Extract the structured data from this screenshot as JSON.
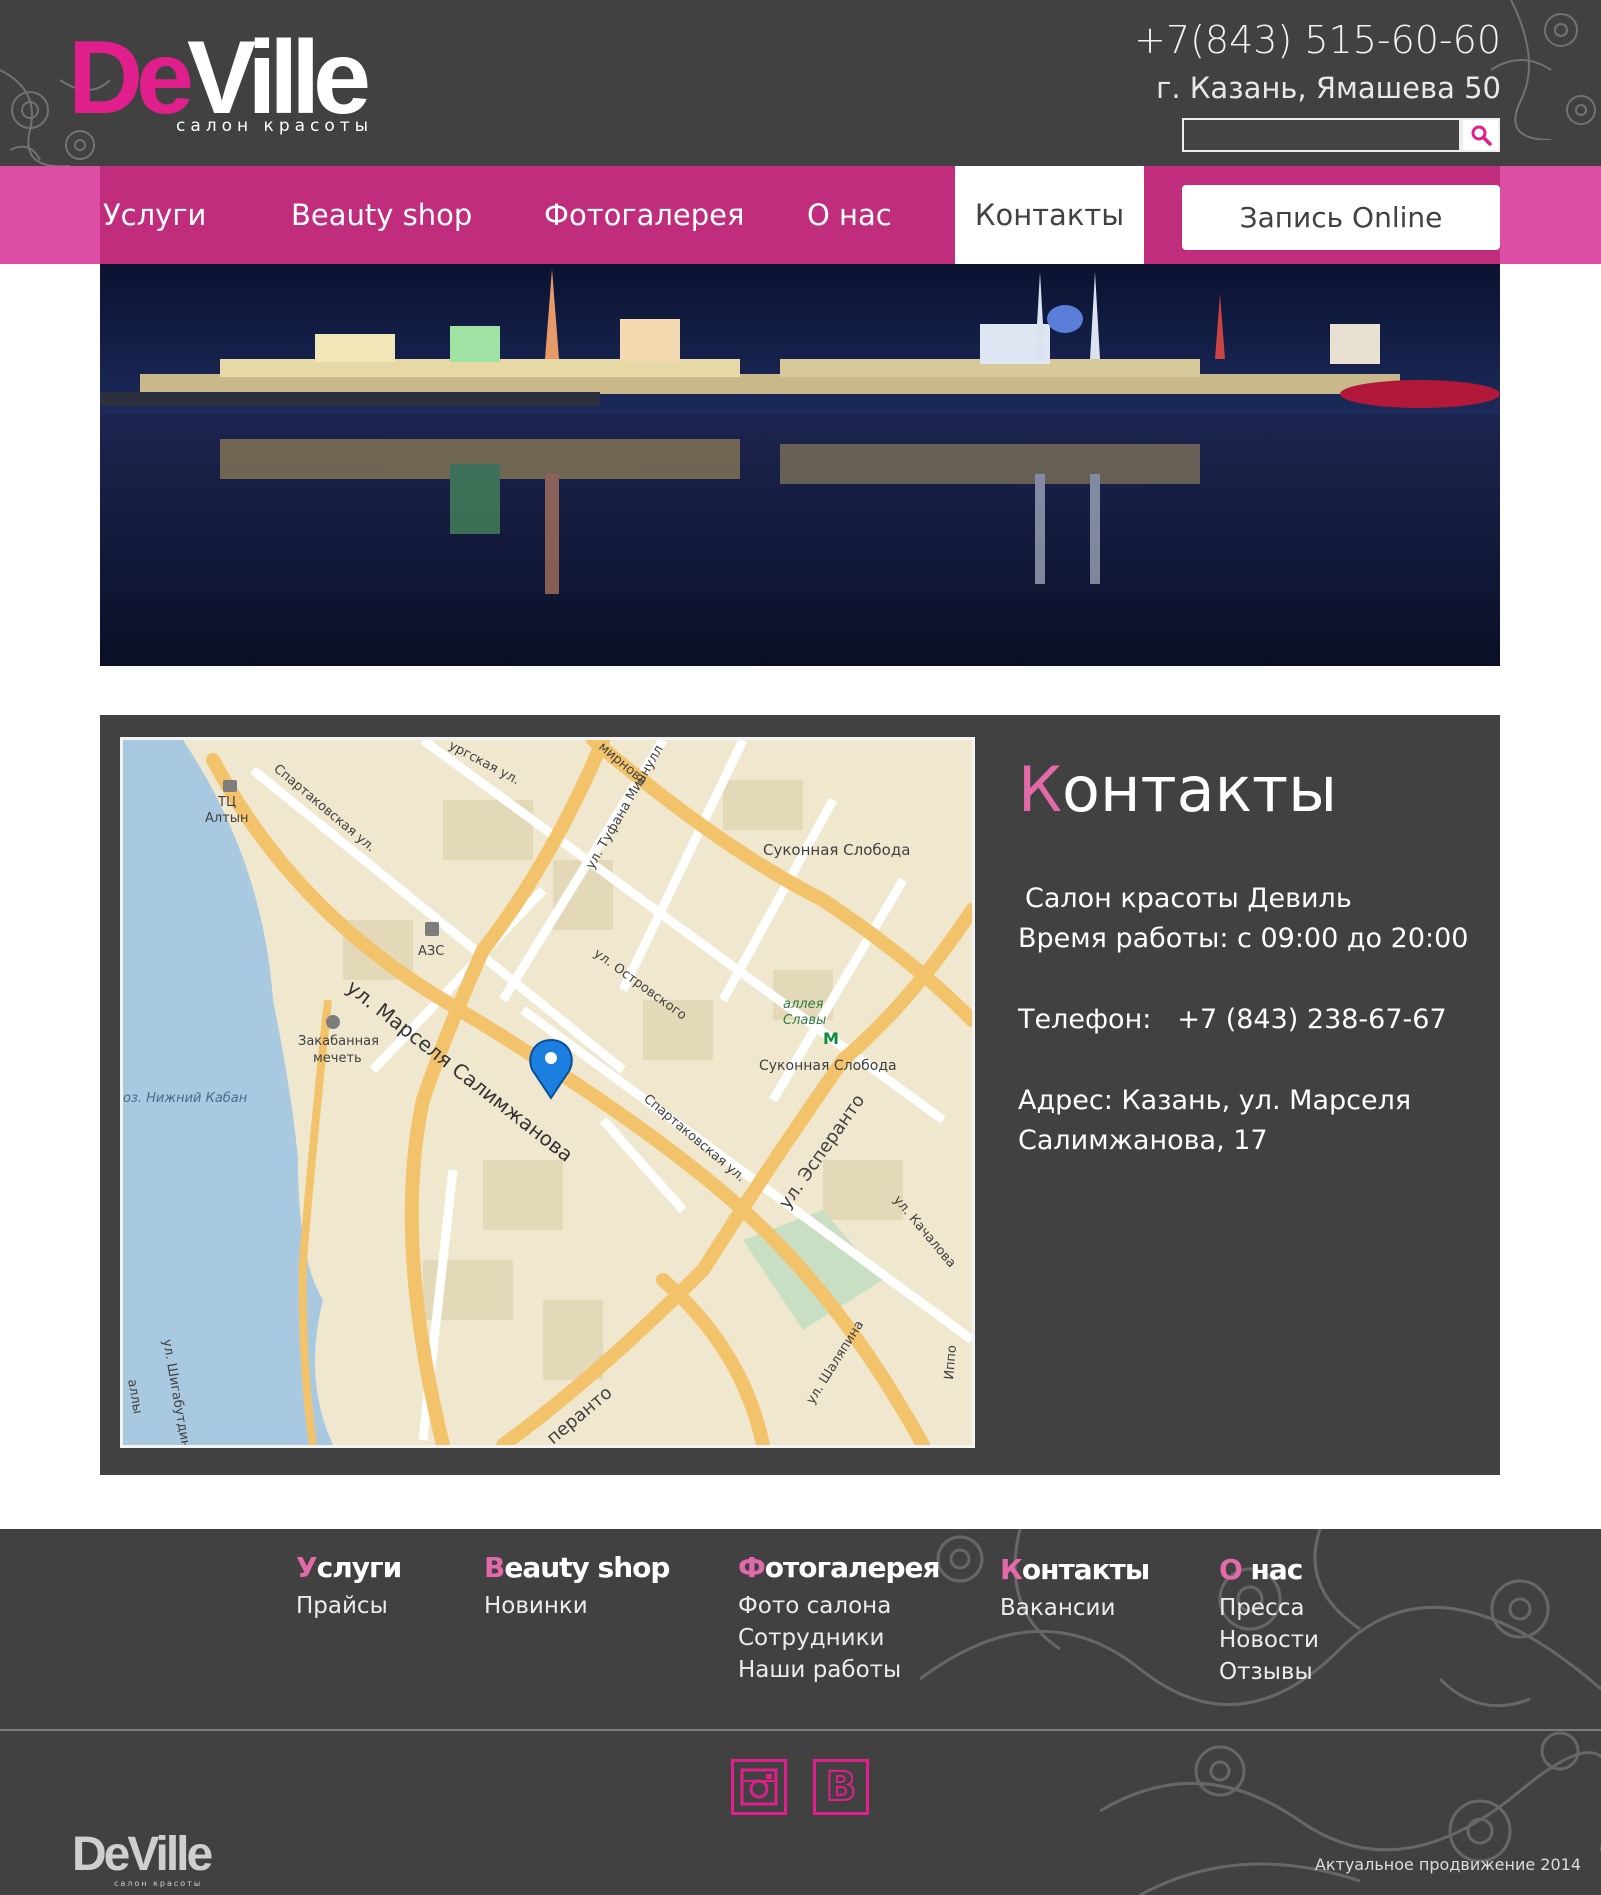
{
  "header": {
    "logo_de": "De",
    "logo_ville": "Ville",
    "logo_subtitle": "салон красоты",
    "phone": "+7(843) 515-60-60",
    "address": "г. Казань, Ямашева 50",
    "search_placeholder": "",
    "search_icon": "search-icon"
  },
  "nav": {
    "items": [
      {
        "label": "Услуги"
      },
      {
        "label": "Beauty shop"
      },
      {
        "label": "Фотогалерея"
      },
      {
        "label": "О нас"
      },
      {
        "label": "Контакты",
        "active": true
      }
    ],
    "cta_label": "Запись Online"
  },
  "hero": {
    "description": "Kazan Kremlin night panorama"
  },
  "contacts": {
    "title_first": "К",
    "title_rest": "онтакты",
    "salon": "Салон красоты Девиль",
    "hours": "Время работы: с 09:00 до 20:00",
    "phone_label": "Телефон:",
    "phone_value": "+7 (843) 238-67-67",
    "address_line1": "Адрес: Казань, ул. Марселя",
    "address_line2": "Салимжанова, 17"
  },
  "map": {
    "labels": {
      "tc": "ТЦ",
      "altyn": "Алтын",
      "spartak1": "Спартаковская ул.",
      "surgskaya": "ургская ул.",
      "mirnova": "мирнова",
      "tufana": "ул. Туфана Миннулл",
      "sukonnaya1": "Суконная Слобода",
      "azs": "АЗС",
      "ostrovskogo": "ул. Островского",
      "alleya1": "аллея",
      "alleya2": "Славы",
      "metro": "М",
      "sukonnaya2": "Суконная Слобода",
      "mosque1": "Закабанная",
      "mosque2": "мечеть",
      "kaban": "оз. Нижний Кабан",
      "salimzhanova": "ул. Марселя Салимжанова",
      "spartak2": "Спартаковская ул.",
      "esperanto1": "ул. Эсперанто",
      "kachalova": "ул. Качалова",
      "shalyapina": "ул. Шаляпина",
      "shigabutdina": "ул. Шигабутдин",
      "esperanto2": "перанто",
      "ippo": "Иппо",
      "tullya": "аллы"
    }
  },
  "footer": {
    "columns": [
      {
        "first": "У",
        "rest": "слуги",
        "links": [
          "Прайсы"
        ]
      },
      {
        "first": "B",
        "rest": "eauty shop",
        "links": [
          "Новинки"
        ]
      },
      {
        "first": "Ф",
        "rest": "отогалерея",
        "links": [
          "Фото салона",
          "Сотрудники",
          "Наши работы"
        ]
      },
      {
        "first": "К",
        "rest": "онтакты",
        "links": [
          "Вакансии"
        ]
      },
      {
        "first": "О",
        "rest": " нас",
        "links": [
          "Пресса",
          "Новости",
          "Отзывы"
        ]
      }
    ],
    "social": [
      {
        "name": "instagram-icon"
      },
      {
        "name": "vk-icon",
        "letter": "B"
      }
    ],
    "logo_de": "De",
    "logo_ville": "Ville",
    "logo_subtitle": "салон красоты",
    "copyright": "Актуальное продвижение 2014"
  },
  "colors": {
    "brand_pink": "#e01e8c",
    "nav_bg": "#bf2d7c",
    "nav_outer": "#dc4da4",
    "dark_bg": "#414142",
    "map_bg": "#efe8cf",
    "water": "#a9c9e0",
    "road": "#f3c36c"
  }
}
